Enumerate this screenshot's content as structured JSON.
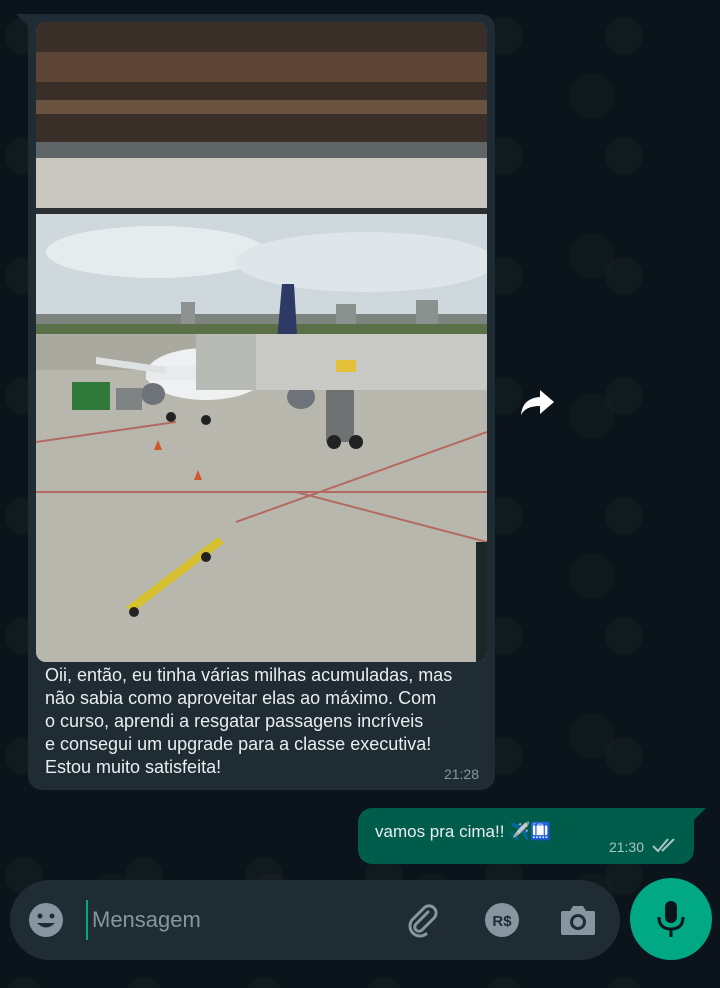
{
  "chat": {
    "incoming": {
      "photo_icon": "airport-photo",
      "text": "Oii, então, eu tinha várias milhas acumuladas, mas\nnão sabia como aproveitar elas ao máximo. Com\no curso, aprendi a resgatar passagens incríveis\ne consegui um upgrade para a classe executiva!\nEstou muito satisfeita!",
      "time": "21:28"
    },
    "outgoing": {
      "text": "vamos pra cima!! ✈️🛄",
      "time": "21:30",
      "status_icon": "double-check-icon"
    }
  },
  "forward_icon": "forward-arrow-icon",
  "composer": {
    "placeholder": "Mensagem",
    "emoji_icon": "emoji-icon",
    "attach_icon": "paperclip-icon",
    "payment_icon": "rupee-payment-icon",
    "payment_label": "R$",
    "camera_icon": "camera-icon",
    "mic_icon": "microphone-icon"
  },
  "colors": {
    "background": "#0b141a",
    "incoming_bubble": "#202c33",
    "outgoing_bubble": "#005c4b",
    "accent": "#00a884",
    "text": "#e9edef",
    "meta": "#8696a0"
  }
}
